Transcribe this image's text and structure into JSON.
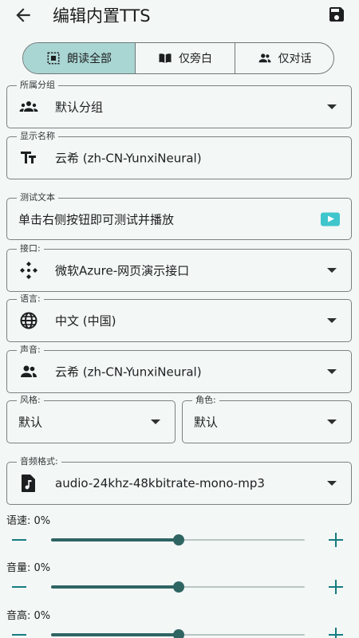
{
  "header": {
    "title": "编辑内置TTS",
    "back_icon": "arrow-back-icon",
    "save_icon": "save-icon"
  },
  "tabs": [
    {
      "label": "朗读全部",
      "icon": "read-all-icon",
      "selected": true
    },
    {
      "label": "仅旁白",
      "icon": "book-icon",
      "selected": false
    },
    {
      "label": "仅对话",
      "icon": "people-icon",
      "selected": false
    }
  ],
  "fields": {
    "group": {
      "label": "所属分组",
      "value": "默认分组"
    },
    "display_name": {
      "label": "显示名称",
      "value": "云希 (zh-CN-YunxiNeural)"
    },
    "test_text": {
      "label": "测试文本",
      "value": "单击右侧按钮即可测试并播放"
    },
    "api": {
      "label": "接口:",
      "value": "微软Azure-网页演示接口"
    },
    "language": {
      "label": "语言:",
      "value": "中文 (中国)"
    },
    "voice": {
      "label": "声音:",
      "value": "云希 (zh-CN-YunxiNeural)"
    },
    "style": {
      "label": "风格:",
      "value": "默认"
    },
    "role": {
      "label": "角色:",
      "value": "默认"
    },
    "audio_format": {
      "label": "音频格式:",
      "value": "audio-24khz-48kbitrate-mono-mp3"
    }
  },
  "sliders": [
    {
      "label": "语速: 0%",
      "value_fraction": 0.5
    },
    {
      "label": "音量: 0%",
      "value_fraction": 0.5
    },
    {
      "label": "音高: 0%",
      "value_fraction": 0.5
    }
  ],
  "colors": {
    "accent": "#2e6563",
    "selected_tab": "#a9d5d3",
    "play_button": "#3fc6cc",
    "background": "#f3f7f6"
  }
}
